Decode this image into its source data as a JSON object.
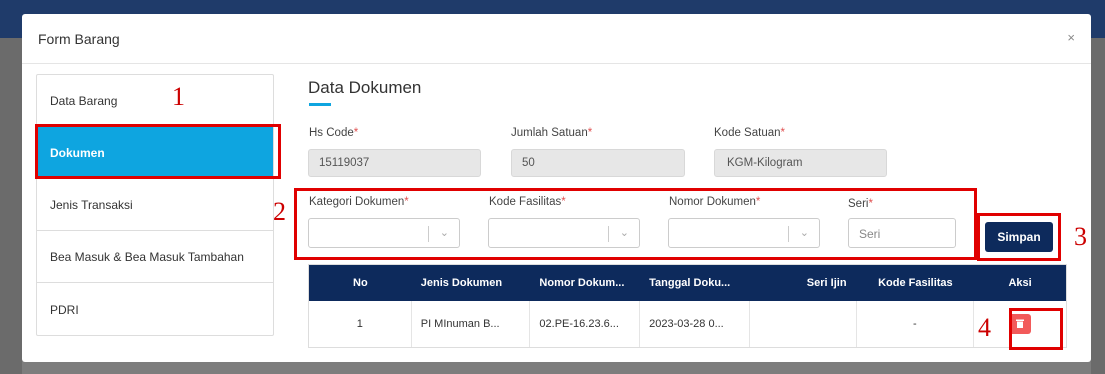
{
  "modal": {
    "title": "Form Barang",
    "close": "×"
  },
  "sidebar": {
    "items": [
      {
        "label": "Data Barang"
      },
      {
        "label": "Dokumen"
      },
      {
        "label": "Jenis Transaksi"
      },
      {
        "label": "Bea Masuk & Bea Masuk Tambahan"
      },
      {
        "label": "PDRI"
      }
    ]
  },
  "section": {
    "title": "Data Dokumen"
  },
  "fields": {
    "hs_code": {
      "label": "Hs Code",
      "value": "15119037"
    },
    "jumlah_satuan": {
      "label": "Jumlah Satuan",
      "value": "50"
    },
    "kode_satuan": {
      "label": "Kode Satuan",
      "value": "KGM-Kilogram"
    },
    "kategori_dokumen": {
      "label": "Kategori Dokumen"
    },
    "kode_fasilitas": {
      "label": "Kode Fasilitas"
    },
    "nomor_dokumen": {
      "label": "Nomor Dokumen"
    },
    "seri": {
      "label": "Seri",
      "placeholder": "Seri"
    }
  },
  "required_mark": "*",
  "buttons": {
    "simpan": "Simpan"
  },
  "table": {
    "headers": [
      "No",
      "Jenis Dokumen",
      "Nomor Dokum...",
      "Tanggal Doku...",
      "Seri Ijin",
      "Kode Fasilitas",
      "Aksi"
    ],
    "rows": [
      {
        "no": "1",
        "jenis": "PI MInuman B...",
        "nomor": "02.PE-16.23.6...",
        "tanggal": "2023-03-28 0...",
        "seri_ijin": "",
        "kode_fasilitas": "-"
      }
    ]
  },
  "annotations": [
    "1",
    "2",
    "3",
    "4"
  ],
  "colors": {
    "accent": "#0ea5e0",
    "navy": "#0d2a5c",
    "annotation_red": "#e00000",
    "delete_red": "#f25a5a"
  },
  "icons": {
    "close": "close-icon",
    "chevron": "chevron-down-icon",
    "delete": "trash-icon"
  }
}
